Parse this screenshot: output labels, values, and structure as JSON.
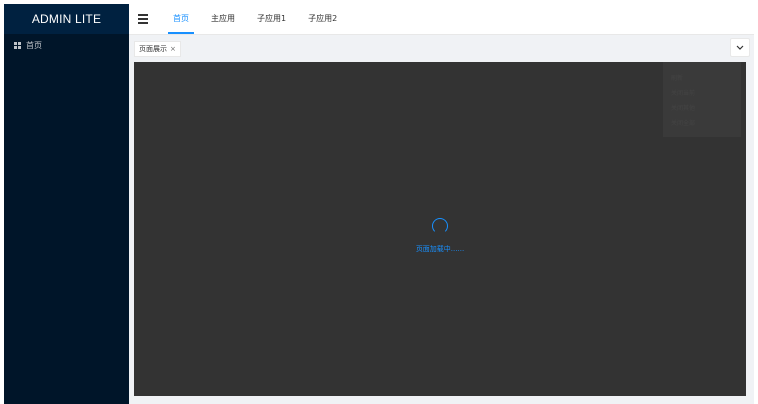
{
  "app": {
    "title": "ADMIN LITE"
  },
  "sidebar": {
    "items": [
      {
        "label": "首页",
        "icon": "grid-icon"
      }
    ]
  },
  "header": {
    "menu_icon": "hamburger-icon",
    "tabs": [
      {
        "label": "首页",
        "active": true
      },
      {
        "label": "主应用",
        "active": false
      },
      {
        "label": "子应用1",
        "active": false
      },
      {
        "label": "子应用2",
        "active": false
      }
    ]
  },
  "tabbar": {
    "tabs": [
      {
        "label": "页面展示",
        "close": "×"
      }
    ],
    "dropdown_icon": "chevron-down-icon"
  },
  "context_menu": {
    "items": [
      "刷新",
      "关闭当前",
      "关闭其他",
      "关闭全部"
    ]
  },
  "content": {
    "loading_text": "页面加载中......"
  },
  "colors": {
    "sidebar_bg": "#001529",
    "accent": "#1890ff",
    "content_bg": "#333333"
  }
}
